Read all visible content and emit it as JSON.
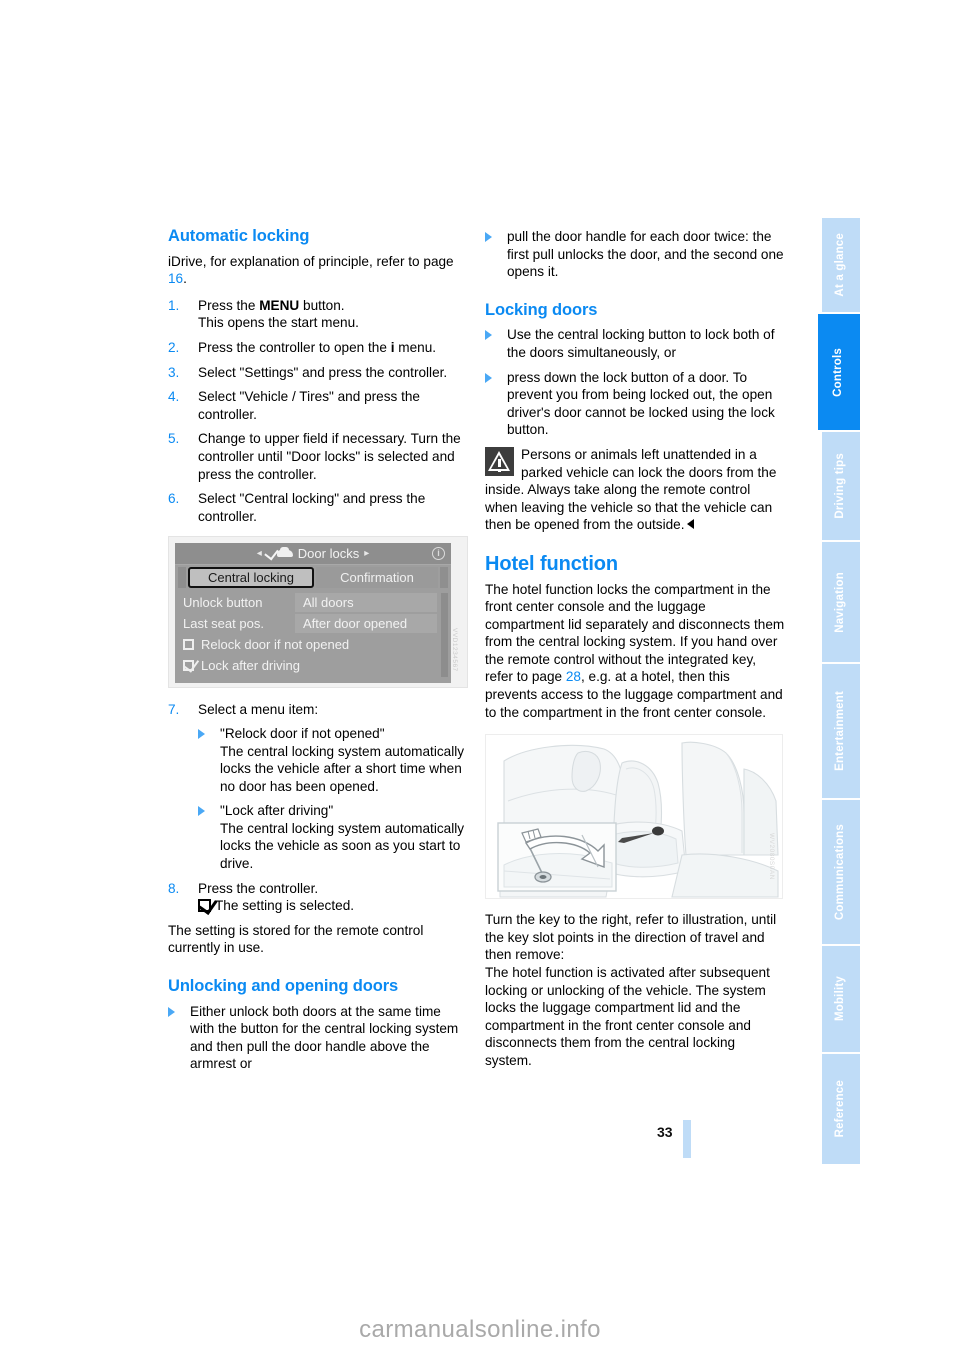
{
  "sidebar": {
    "tabs": [
      {
        "label": "At a glance",
        "active": false
      },
      {
        "label": "Controls",
        "active": true
      },
      {
        "label": "Driving tips",
        "active": false
      },
      {
        "label": "Navigation",
        "active": false
      },
      {
        "label": "Entertainment",
        "active": false
      },
      {
        "label": "Communications",
        "active": false
      },
      {
        "label": "Mobility",
        "active": false
      },
      {
        "label": "Reference",
        "active": false
      }
    ]
  },
  "left_column": {
    "heading_automatic_locking": "Automatic locking",
    "intro_1": "iDrive, for explanation of principle, refer to page ",
    "intro_pageref": "16",
    "intro_2": ".",
    "steps": [
      {
        "num": "1.",
        "text_a": "Press the ",
        "bold": "MENU",
        "text_b": " button.",
        "sub": "This opens the start menu."
      },
      {
        "num": "2.",
        "text_a": "Press the controller to open the ",
        "bold": "i",
        "text_b": " menu.",
        "sub": ""
      },
      {
        "num": "3.",
        "text_a": "Select \"Settings\" and press the controller.",
        "bold": "",
        "text_b": "",
        "sub": ""
      },
      {
        "num": "4.",
        "text_a": "Select \"Vehicle / Tires\" and press the controller.",
        "bold": "",
        "text_b": "",
        "sub": ""
      },
      {
        "num": "5.",
        "text_a": "Change to upper field if necessary. Turn the controller until \"Door locks\" is selected and press the controller.",
        "bold": "",
        "text_b": "",
        "sub": ""
      },
      {
        "num": "6.",
        "text_a": "Select \"Central locking\" and press the controller.",
        "bold": "",
        "text_b": "",
        "sub": ""
      }
    ],
    "step7_num": "7.",
    "step7_label": "Select a menu item:",
    "step7_items": [
      {
        "title": "\"Relock door if not opened\"",
        "body": "The central locking system automatically locks the vehicle after a short time when no door has been opened."
      },
      {
        "title": "\"Lock after driving\"",
        "body": "The central locking system automatically locks the vehicle as soon as you start to drive."
      }
    ],
    "step8_num": "8.",
    "step8_text": "Press the controller.",
    "step8_sub": "The setting is selected.",
    "stored_note": "The setting is stored for the remote control currently in use.",
    "heading_unlocking": "Unlocking and opening doors",
    "unlock_bullet": "Either unlock both doors at the same time with the button for the central locking system and then pull the door handle above the armrest or"
  },
  "idrive_screen": {
    "title": "Door locks",
    "left_arrow": "◂",
    "right_arrow": "▸",
    "info_glyph": "i",
    "tabs": [
      {
        "label": "Central locking",
        "selected": true
      },
      {
        "label": "Confirmation",
        "selected": false
      }
    ],
    "rows": [
      {
        "label": "Unlock button",
        "value": "All doors"
      },
      {
        "label": "Last seat pos.",
        "value": "After door opened"
      }
    ],
    "checkboxes": [
      {
        "label": "Relock door if not opened",
        "checked": false
      },
      {
        "label": "Lock after driving",
        "checked": true
      }
    ],
    "watermark": "VVD1234567"
  },
  "right_column": {
    "pull_bullet": "pull the door handle for each door twice: the first pull unlocks the door, and the second one opens it.",
    "heading_locking": "Locking doors",
    "locking_bullets": [
      "Use the central locking button to lock both of the doors simultaneously, or",
      "press down the lock button of a door. To prevent you from being locked out, the open driver's door cannot be locked using the lock button."
    ],
    "warning_text": "Persons or animals left unattended in a parked vehicle can lock the doors from the inside. Always take along the remote control when leaving the vehicle so that the vehicle can then be opened from the outside.",
    "heading_hotel": "Hotel function",
    "hotel_p1_a": "The hotel function locks the compartment in the front center console and the luggage compartment lid separately and disconnects them from the central locking system. If you hand over the remote control without the integrated key, refer to page ",
    "hotel_pageref": "28",
    "hotel_p1_b": ", e.g. at a hotel, then this prevents access to the luggage compartment and to the compartment in the front center console.",
    "hotel_p2": "Turn the key to the right, refer to illustration, until the key slot points in the direction of travel and then remove:",
    "hotel_p3": "The hotel function is activated after subsequent locking or unlocking of the vehicle. The system locks the luggage compartment lid and the compartment in the front center console and disconnects them from the central locking system.",
    "illustration_watermark": "WV2080S0AN"
  },
  "footer": {
    "page_number": "33",
    "watermark": "carmanualsonline.info"
  },
  "colors": {
    "accent_blue": "#0b8af2",
    "tab_inactive": "#bfdcf7",
    "bullet_blue": "#4aa8f5"
  }
}
